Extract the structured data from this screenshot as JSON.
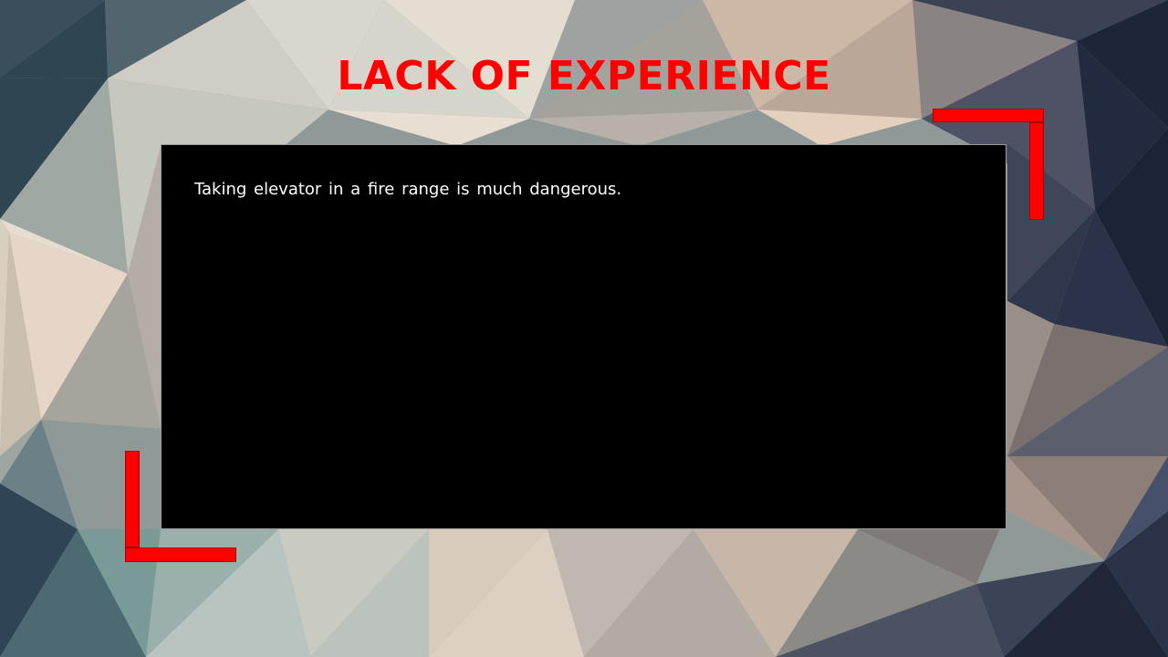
{
  "slide": {
    "title": "LACK OF EXPERIENCE",
    "body_text": "Taking elevator in a fire range is much dangerous."
  },
  "colors": {
    "accent": "#ff0000",
    "content_background": "#000000",
    "body_text": "#ffffff"
  },
  "decorations": {
    "background": "low-poly-geometric-pattern",
    "corner_brackets": [
      "top-right",
      "bottom-left"
    ]
  }
}
